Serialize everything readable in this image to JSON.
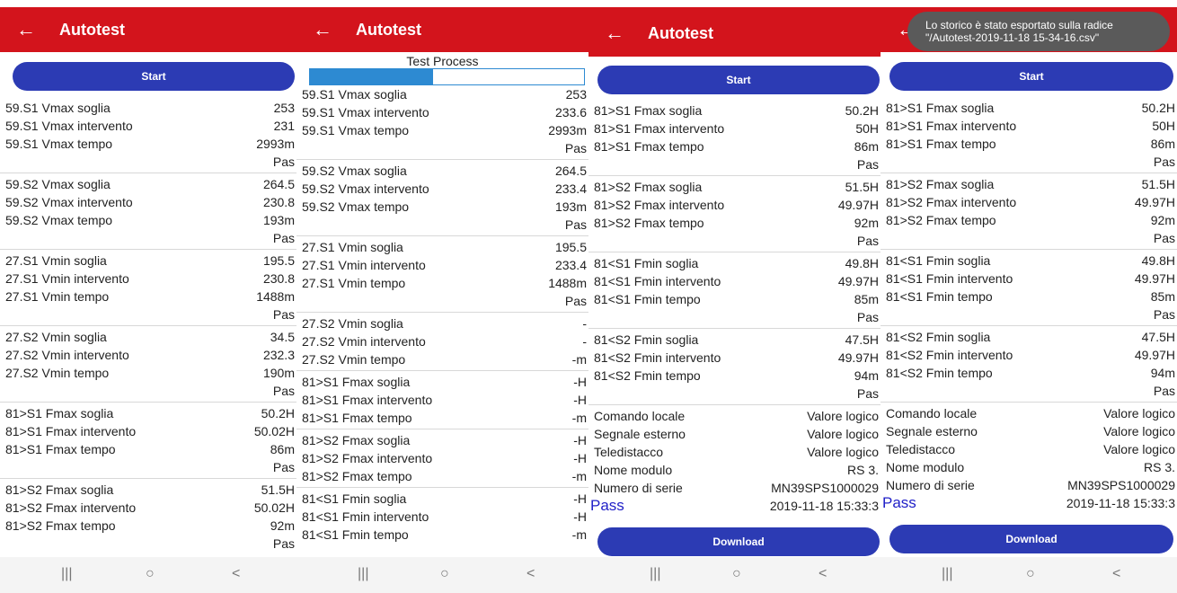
{
  "title": "Autotest",
  "start_label": "Start",
  "download_label": "Download",
  "test_process_label": "Test Process",
  "progress_fraction": 0.45,
  "pass_label": "Pass",
  "toast_text": "Lo storico è stato esportato sulla radice\n\"/Autotest-2019-11-18 15-34-16.csv\"",
  "panel1_groups": [
    [
      [
        "59.S1 Vmax soglia",
        "253"
      ],
      [
        "59.S1 Vmax intervento",
        "231"
      ],
      [
        "59.S1 Vmax tempo",
        "2993m"
      ],
      [
        "",
        "Pas"
      ]
    ],
    [
      [
        "59.S2 Vmax soglia",
        "264.5"
      ],
      [
        "59.S2 Vmax intervento",
        "230.8"
      ],
      [
        "59.S2 Vmax tempo",
        "193m"
      ],
      [
        "",
        "Pas"
      ]
    ],
    [
      [
        "27.S1 Vmin soglia",
        "195.5"
      ],
      [
        "27.S1 Vmin intervento",
        "230.8"
      ],
      [
        "27.S1 Vmin tempo",
        "1488m"
      ],
      [
        "",
        "Pas"
      ]
    ],
    [
      [
        "27.S2 Vmin soglia",
        "34.5"
      ],
      [
        "27.S2 Vmin intervento",
        "232.3"
      ],
      [
        "27.S2 Vmin tempo",
        "190m"
      ],
      [
        "",
        "Pas"
      ]
    ],
    [
      [
        "81>S1 Fmax soglia",
        "50.2H"
      ],
      [
        "81>S1 Fmax intervento",
        "50.02H"
      ],
      [
        "81>S1 Fmax tempo",
        "86m"
      ],
      [
        "",
        "Pas"
      ]
    ],
    [
      [
        "81>S2 Fmax soglia",
        "51.5H"
      ],
      [
        "81>S2 Fmax intervento",
        "50.02H"
      ],
      [
        "81>S2 Fmax tempo",
        "92m"
      ],
      [
        "",
        "Pas"
      ]
    ]
  ],
  "panel2_groups": [
    [
      [
        "59.S1 Vmax soglia",
        "253"
      ],
      [
        "59.S1 Vmax intervento",
        "233.6"
      ],
      [
        "59.S1 Vmax tempo",
        "2993m"
      ],
      [
        "",
        "Pas"
      ]
    ],
    [
      [
        "59.S2 Vmax soglia",
        "264.5"
      ],
      [
        "59.S2 Vmax intervento",
        "233.4"
      ],
      [
        "59.S2 Vmax tempo",
        "193m"
      ],
      [
        "",
        "Pas"
      ]
    ],
    [
      [
        "27.S1 Vmin soglia",
        "195.5"
      ],
      [
        "27.S1 Vmin intervento",
        "233.4"
      ],
      [
        "27.S1 Vmin tempo",
        "1488m"
      ],
      [
        "",
        "Pas"
      ]
    ],
    [
      [
        "27.S2 Vmin soglia",
        "-"
      ],
      [
        "27.S2 Vmin intervento",
        "-"
      ],
      [
        "27.S2 Vmin tempo",
        "-m"
      ]
    ],
    [
      [
        "81>S1 Fmax soglia",
        "-H"
      ],
      [
        "81>S1 Fmax intervento",
        "-H"
      ],
      [
        "81>S1 Fmax tempo",
        "-m"
      ]
    ],
    [
      [
        "81>S2 Fmax soglia",
        "-H"
      ],
      [
        "81>S2 Fmax intervento",
        "-H"
      ],
      [
        "81>S2 Fmax tempo",
        "-m"
      ]
    ],
    [
      [
        "81<S1 Fmin soglia",
        "-H"
      ],
      [
        "81<S1 Fmin intervento",
        "-H"
      ],
      [
        "81<S1 Fmin tempo",
        "-m"
      ]
    ]
  ],
  "panel3_groups": [
    [
      [
        "81>S1 Fmax soglia",
        "50.2H"
      ],
      [
        "81>S1 Fmax intervento",
        "50H"
      ],
      [
        "81>S1 Fmax tempo",
        "86m"
      ],
      [
        "",
        "Pas"
      ]
    ],
    [
      [
        "81>S2 Fmax soglia",
        "51.5H"
      ],
      [
        "81>S2 Fmax intervento",
        "49.97H"
      ],
      [
        "81>S2 Fmax tempo",
        "92m"
      ],
      [
        "",
        "Pas"
      ]
    ],
    [
      [
        "81<S1 Fmin soglia",
        "49.8H"
      ],
      [
        "81<S1 Fmin intervento",
        "49.97H"
      ],
      [
        "81<S1 Fmin tempo",
        "85m"
      ],
      [
        "",
        "Pas"
      ]
    ],
    [
      [
        "81<S2 Fmin soglia",
        "47.5H"
      ],
      [
        "81<S2 Fmin intervento",
        "49.97H"
      ],
      [
        "81<S2 Fmin tempo",
        "94m"
      ],
      [
        "",
        "Pas"
      ]
    ],
    [
      [
        "Comando locale",
        "Valore logico"
      ],
      [
        "Segnale esterno",
        "Valore logico"
      ],
      [
        "Teledistacco",
        "Valore logico"
      ],
      [
        "Nome modulo",
        "RS 3."
      ],
      [
        "Numero di serie",
        "MN39SPS1000029"
      ],
      [
        "",
        "2019-11-18 15:33:3"
      ]
    ]
  ],
  "panel4_groups": [
    [
      [
        "81>S1 Fmax soglia",
        "50.2H"
      ],
      [
        "81>S1 Fmax intervento",
        "50H"
      ],
      [
        "81>S1 Fmax tempo",
        "86m"
      ],
      [
        "",
        "Pas"
      ]
    ],
    [
      [
        "81>S2 Fmax soglia",
        "51.5H"
      ],
      [
        "81>S2 Fmax intervento",
        "49.97H"
      ],
      [
        "81>S2 Fmax tempo",
        "92m"
      ],
      [
        "",
        "Pas"
      ]
    ],
    [
      [
        "81<S1 Fmin soglia",
        "49.8H"
      ],
      [
        "81<S1 Fmin intervento",
        "49.97H"
      ],
      [
        "81<S1 Fmin tempo",
        "85m"
      ],
      [
        "",
        "Pas"
      ]
    ],
    [
      [
        "81<S2 Fmin soglia",
        "47.5H"
      ],
      [
        "81<S2 Fmin intervento",
        "49.97H"
      ],
      [
        "81<S2 Fmin tempo",
        "94m"
      ],
      [
        "",
        "Pas"
      ]
    ],
    [
      [
        "Comando locale",
        "Valore logico"
      ],
      [
        "Segnale esterno",
        "Valore logico"
      ],
      [
        "Teledistacco",
        "Valore logico"
      ],
      [
        "Nome modulo",
        "RS 3."
      ],
      [
        "Numero di serie",
        "MN39SPS1000029"
      ],
      [
        "",
        "2019-11-18 15:33:3"
      ]
    ]
  ],
  "nav": {
    "recents_icon": "|||",
    "home_icon": "○",
    "back_icon": "<"
  },
  "colors": {
    "appbar": "#d3141c",
    "button": "#2c3bb4",
    "progress": "#2d8ad2",
    "pass_text": "#2121c8"
  }
}
